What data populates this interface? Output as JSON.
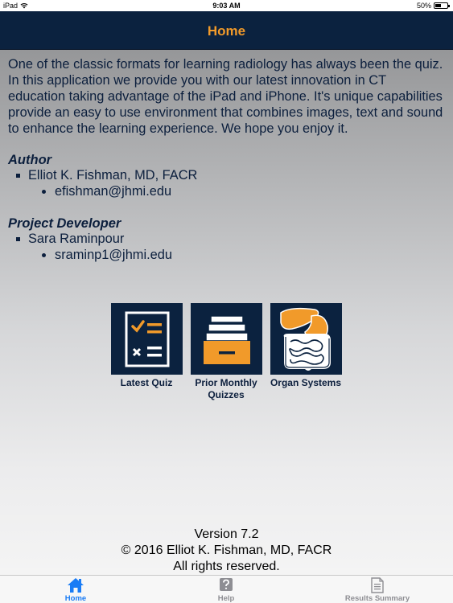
{
  "status_bar": {
    "device": "iPad",
    "time": "9:03 AM",
    "battery": "50%"
  },
  "nav": {
    "title": "Home"
  },
  "intro": {
    "text": "One of the classic formats for learning radiology has always been the quiz. In this application we provide you with our latest innovation in CT education taking advantage of the iPad and iPhone. It's unique capabilities provide an easy to use environment that combines images, text and sound to enhance the learning experience. We hope you enjoy it."
  },
  "author": {
    "heading": "Author",
    "name": "Elliot K. Fishman, MD, FACR",
    "email": "efishman@jhmi.edu"
  },
  "developer": {
    "heading": "Project Developer",
    "name": "Sara Raminpour",
    "email": "sraminp1@jhmi.edu"
  },
  "tiles": [
    {
      "label": "Latest Quiz"
    },
    {
      "label": "Prior Monthly Quizzes"
    },
    {
      "label": "Organ Systems"
    }
  ],
  "footer": {
    "version": "Version 7.2",
    "copyright": "© 2016 Elliot K. Fishman, MD, FACR",
    "rights": "All rights reserved."
  },
  "tab_bar": {
    "items": [
      {
        "label": "Home",
        "icon": "house-icon",
        "active": true
      },
      {
        "label": "Help",
        "icon": "question-icon",
        "active": false
      },
      {
        "label": "Results Summary",
        "icon": "document-icon",
        "active": false
      }
    ]
  },
  "colors": {
    "navy": "#0b223f",
    "orange": "#f19a2a",
    "active_tab": "#1a7cf5",
    "inactive_tab": "#8e8e93"
  }
}
